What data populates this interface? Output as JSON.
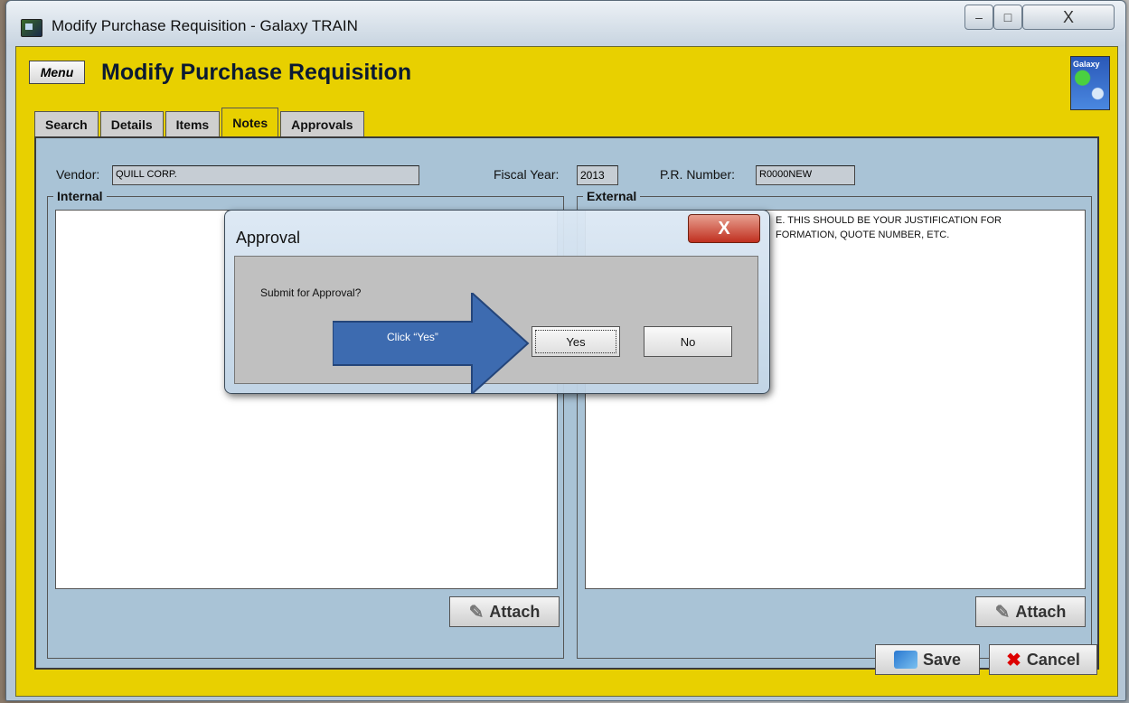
{
  "window": {
    "title": "Modify Purchase Requisition - Galaxy TRAIN",
    "controls": [
      "–",
      "□",
      "X"
    ]
  },
  "app": {
    "menu_label": "Menu",
    "title": "Modify Purchase Requisition",
    "logo_text": "Galaxy"
  },
  "tabs": [
    {
      "label": "Search",
      "active": false
    },
    {
      "label": "Details",
      "active": false
    },
    {
      "label": "Items",
      "active": false
    },
    {
      "label": "Notes",
      "active": true
    },
    {
      "label": "Approvals",
      "active": false
    }
  ],
  "form": {
    "vendor_label": "Vendor:",
    "vendor_value": "QUILL CORP.",
    "fiscal_year_label": "Fiscal Year:",
    "fiscal_year_value": "2013",
    "pr_number_label": "P.R. Number:",
    "pr_number_value": "R0000NEW"
  },
  "notes": {
    "internal_label": "Internal",
    "external_label": "External",
    "external_text_line1": "E.  THIS SHOULD BE YOUR JUSTIFICATION FOR",
    "external_text_line2": "FORMATION, QUOTE NUMBER, ETC.",
    "attach_label": "Attach"
  },
  "footer": {
    "save_label": "Save",
    "cancel_label": "Cancel"
  },
  "dialog": {
    "title": "Approval",
    "close_label": "X",
    "message": "Submit for Approval?",
    "yes_label": "Yes",
    "no_label": "No",
    "callout": "Click “Yes”"
  },
  "colors": {
    "app_bg": "#e8d000",
    "panel_bg": "#a9c3d6",
    "arrow": "#3d6bb0"
  }
}
